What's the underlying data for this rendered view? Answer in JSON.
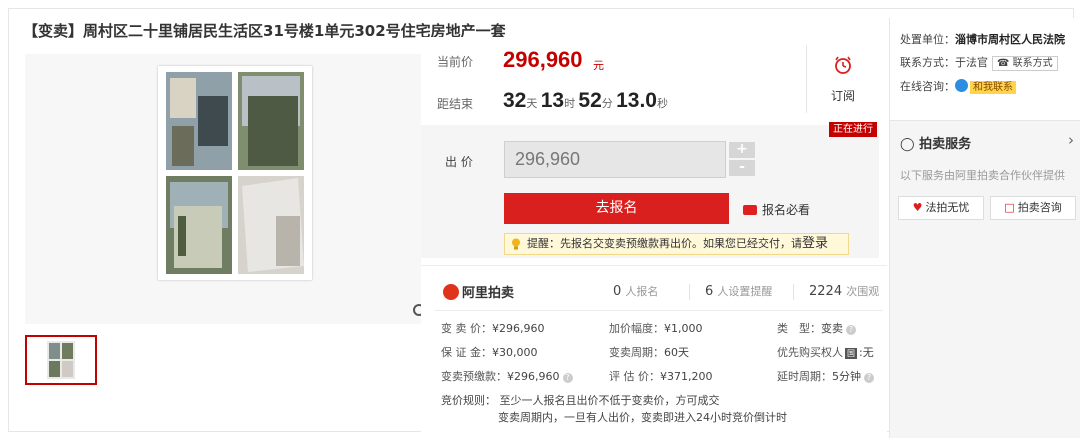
{
  "title": {
    "tag": "【变卖】",
    "text": "周村区二十里铺居民生活区31号楼1单元302号住宅房地产一套"
  },
  "price": {
    "current_label": "当前价",
    "current_value": "296,960",
    "current_unit": "元",
    "countdown_label": "距结束",
    "countdown": {
      "days": "32",
      "days_unit": "天",
      "hours": "13",
      "hours_unit": "时",
      "minutes": "52",
      "minutes_unit": "分",
      "seconds": "13.0",
      "seconds_unit": "秒"
    },
    "subscribe_label": "订阅"
  },
  "bid": {
    "status_badge": "正在进行",
    "bid_label": "出 价",
    "bid_value": "296,960",
    "plus": "+",
    "minus": "-",
    "signup_button": "去报名",
    "must_read": "报名必看",
    "tip_text": "提醒：先报名交变卖预缴款再出价。如果您已经交付，请",
    "tip_link": "登录"
  },
  "info": {
    "brand": "阿里拍卖",
    "stats": [
      {
        "num": "0",
        "unit": "人报名"
      },
      {
        "num": "6",
        "unit": "人设置提醒"
      },
      {
        "num": "2224",
        "unit": "次围观"
      }
    ],
    "rows": [
      {
        "k": "变 卖 价：",
        "v": "¥296,960"
      },
      {
        "k": "加价幅度：",
        "v": "¥1,000"
      },
      {
        "k": "类　型：",
        "v": "变卖"
      },
      {
        "k": "保 证 金：",
        "v": "¥30,000"
      },
      {
        "k": "变卖周期：",
        "v": "60天"
      },
      {
        "k": "优先购买权人",
        "v": "无",
        "badge": "国"
      },
      {
        "k": "变卖预缴款：",
        "v": "¥296,960"
      },
      {
        "k": "评 估 价：",
        "v": "¥371,200"
      },
      {
        "k": "延时周期：",
        "v": "5分钟"
      }
    ],
    "rule_label": "竞价规则：",
    "rule_line1": "至少一人报名且出价不低于变卖价，方可成交",
    "rule_line2": "变卖周期内，一旦有人出价，变卖即进入24小时竞价倒计时"
  },
  "sidebar": {
    "unit_label": "处置单位：",
    "unit_value": "淄博市周村区人民法院",
    "contact_label": "联系方式：",
    "contact_value": "于法官",
    "contact_button": "联系方式",
    "chat_label": "在线咨询：",
    "chat_button": "和我联系",
    "service_title": "拍卖服务",
    "service_desc": "以下服务由阿里拍卖合作伙伴提供",
    "service_btn1": "法拍无忧",
    "service_btn2": "拍卖咨询"
  },
  "icons": [
    "clock-icon",
    "zoom-icon",
    "notice-icon",
    "bulb-icon",
    "headset-icon",
    "heart-shield-icon",
    "chat-bubble-icon"
  ],
  "colors": {
    "accent_red": "#c40000",
    "button_red": "#d9201f",
    "tip_bg": "#fff8d9",
    "chat_blue": "#2d8de0",
    "chat_tag": "#ffd34a"
  }
}
